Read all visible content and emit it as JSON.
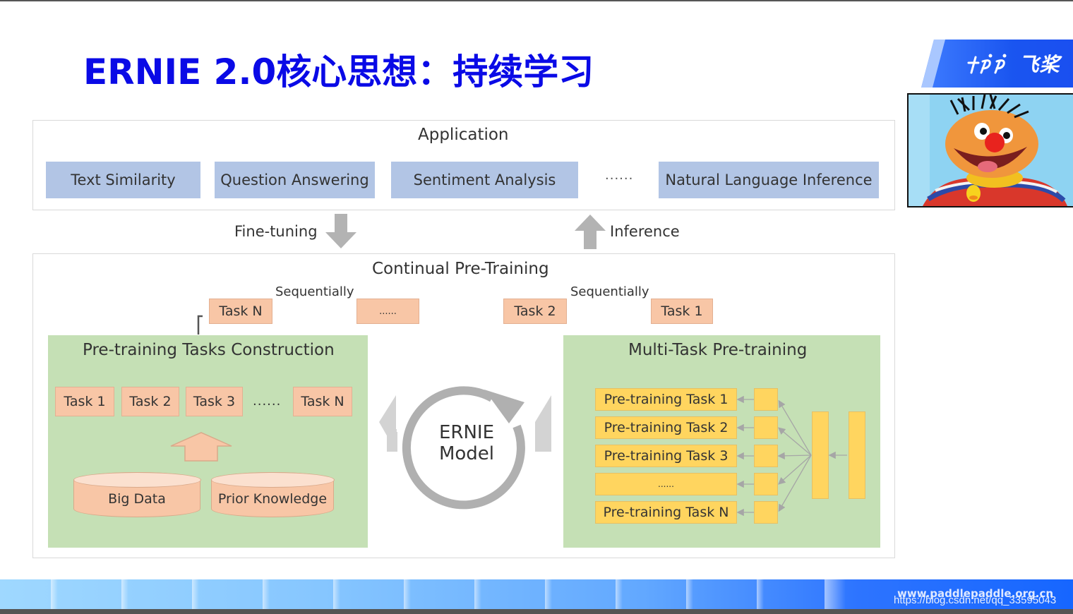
{
  "slide": {
    "title": "ERNIE 2.0核心思想：持续学习",
    "logo_text": "飞桨",
    "logo_mark": "⺊P P"
  },
  "application": {
    "heading": "Application",
    "tasks": [
      "Text Similarity",
      "Question Answering",
      "Sentiment Analysis",
      "Natural Language Inference"
    ],
    "ellipsis": "......"
  },
  "flow": {
    "fine_tuning": "Fine-tuning",
    "inference": "Inference"
  },
  "continual": {
    "heading": "Continual Pre-Training",
    "sequentially_1": "Sequentially",
    "sequentially_2": "Sequentially",
    "sequence": [
      "Task N",
      "......",
      "Task 2",
      "Task 1"
    ]
  },
  "construction": {
    "heading": "Pre-training Tasks Construction",
    "tasks": [
      "Task 1",
      "Task 2",
      "Task 3",
      "Task N"
    ],
    "ellipsis": "......",
    "sources": [
      "Big Data",
      "Prior Knowledge"
    ]
  },
  "model": {
    "line1": "ERNIE",
    "line2": "Model"
  },
  "multitask": {
    "heading": "Multi-Task Pre-training",
    "tasks": [
      "Pre-training Task 1",
      "Pre-training Task 2",
      "Pre-training Task 3",
      "......",
      "Pre-training Task N"
    ]
  },
  "footer": {
    "site": "www.paddlepaddle.org.cn",
    "watermark": "https://blog.csdn.net/qq_33595043"
  },
  "colors": {
    "title_blue": "#0a0ae6",
    "app_box": "#b2c5e5",
    "task_peach": "#f8c6a6",
    "panel_green": "#c5e0b5",
    "task_yellow": "#ffd55f",
    "arrow_gray": "#b3b3b3"
  }
}
